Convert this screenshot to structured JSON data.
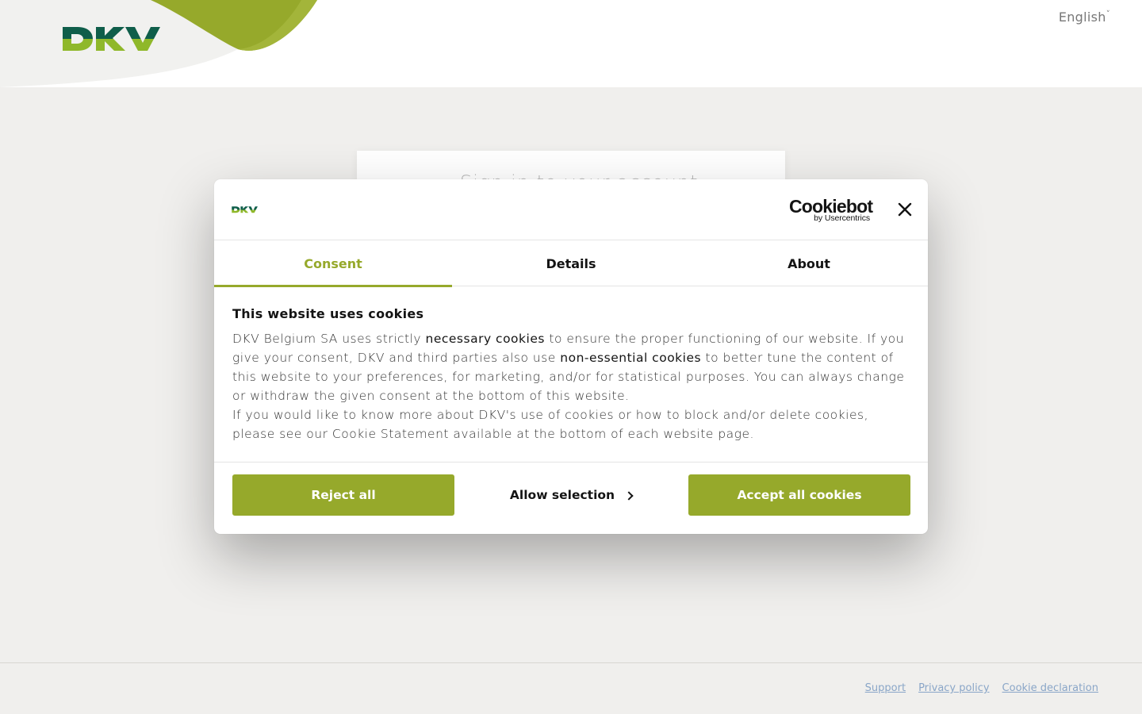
{
  "header": {
    "logo_text": "DKV",
    "language": "English",
    "language_caret": "˅"
  },
  "login": {
    "title": "Sign in to your account"
  },
  "footer": {
    "links": [
      "Support",
      "Privacy policy",
      "Cookie declaration"
    ]
  },
  "cookie_dialog": {
    "logo_text": "DKV",
    "cookiebot_main": "Cookiebot",
    "cookiebot_sub": "by Usercentrics",
    "tabs": [
      "Consent",
      "Details",
      "About"
    ],
    "active_tab": "Consent",
    "heading": "This website uses cookies",
    "p1_a": "DKV Belgium SA uses strictly ",
    "p1_link1": "necessary cookies",
    "p1_b": " to ensure the proper functioning of our website. If you give your consent, DKV and third parties also use ",
    "p1_link2": "non-essential cookies",
    "p1_c": " to better tune the content of this website to your preferences, for marketing, and/or for statistical purposes. You can always change or withdraw the given consent at the bottom of this website.",
    "p2": "If you would like to know more about DKV's use of cookies or how to block and/or delete cookies, please see our Cookie Statement available at the bottom of each website page.",
    "buttons": {
      "reject": "Reject all",
      "allow": "Allow selection",
      "accept": "Accept all cookies"
    }
  },
  "colors": {
    "brand_green": "#96a92b",
    "brand_dark_green": "#0f5e4a",
    "light_green": "#8fb82a"
  }
}
